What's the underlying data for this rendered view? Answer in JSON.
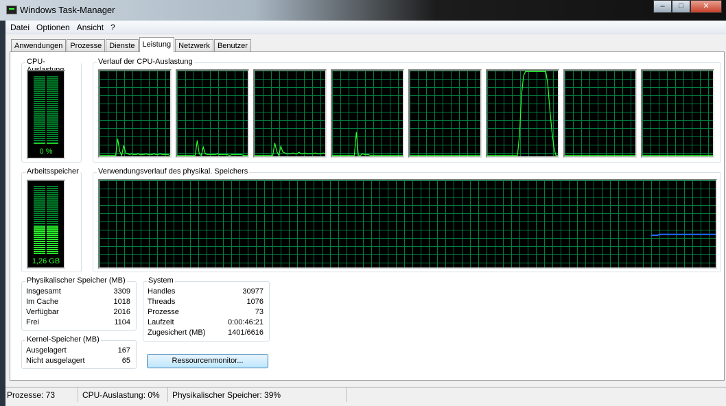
{
  "window": {
    "title": "Windows Task-Manager",
    "buttons": {
      "minimize": "–",
      "maximize": "□",
      "close": "✕"
    }
  },
  "menu": [
    "Datei",
    "Optionen",
    "Ansicht",
    "?"
  ],
  "tabs": [
    {
      "label": "Anwendungen"
    },
    {
      "label": "Prozesse"
    },
    {
      "label": "Dienste"
    },
    {
      "label": "Leistung",
      "active": true
    },
    {
      "label": "Netzwerk"
    },
    {
      "label": "Benutzer"
    }
  ],
  "cpu": {
    "label": "CPU-Auslastung",
    "value": "0 %",
    "percent": 0
  },
  "cpu_history": {
    "label": "Verlauf der CPU-Auslastung",
    "cores": [
      [
        0,
        0,
        0,
        0,
        0,
        0,
        0,
        0,
        0,
        20,
        5,
        0,
        12,
        3,
        2,
        1,
        2,
        1,
        1,
        2,
        1,
        1,
        1,
        2,
        1,
        1,
        1,
        2,
        1,
        1,
        2,
        1,
        1,
        1,
        1,
        0
      ],
      [
        0,
        0,
        0,
        0,
        0,
        0,
        0,
        0,
        0,
        0,
        18,
        2,
        0,
        10,
        2,
        1,
        1,
        1,
        1,
        1,
        2,
        1,
        1,
        1,
        1,
        1,
        0,
        1,
        1,
        1,
        1,
        1,
        1,
        0,
        0,
        0
      ],
      [
        0,
        0,
        0,
        0,
        0,
        0,
        0,
        0,
        0,
        0,
        15,
        5,
        0,
        11,
        4,
        3,
        2,
        2,
        2,
        3,
        2,
        2,
        4,
        2,
        2,
        3,
        2,
        2,
        2,
        2,
        3,
        2,
        2,
        2,
        3,
        2
      ],
      [
        0,
        0,
        0,
        0,
        0,
        0,
        0,
        0,
        0,
        0,
        0,
        0,
        28,
        0,
        0,
        2,
        1,
        1,
        1,
        0,
        0,
        0,
        0,
        0,
        0,
        0,
        0,
        0,
        0,
        0,
        0,
        0,
        0,
        0,
        0,
        0
      ],
      [
        0,
        0,
        0,
        0,
        0,
        0,
        0,
        0,
        0,
        0,
        0,
        0,
        0,
        0,
        0,
        0,
        0,
        0,
        0,
        0,
        0,
        0,
        0,
        0,
        0,
        0,
        0,
        0,
        0,
        0,
        0,
        0,
        0,
        0,
        0,
        0
      ],
      [
        0,
        0,
        0,
        0,
        0,
        0,
        0,
        0,
        0,
        0,
        0,
        0,
        0,
        0,
        0,
        0,
        25,
        72,
        95,
        100,
        100,
        100,
        100,
        100,
        100,
        100,
        100,
        100,
        100,
        100,
        85,
        55,
        30,
        10,
        0,
        0
      ],
      [
        0,
        0,
        0,
        0,
        0,
        0,
        0,
        0,
        0,
        0,
        0,
        0,
        0,
        0,
        0,
        0,
        0,
        0,
        0,
        0,
        0,
        0,
        0,
        0,
        0,
        0,
        0,
        0,
        0,
        0,
        0,
        0,
        0,
        0,
        0,
        0
      ],
      [
        0,
        0,
        0,
        0,
        0,
        0,
        0,
        0,
        0,
        0,
        0,
        0,
        0,
        0,
        0,
        0,
        0,
        0,
        0,
        0,
        0,
        0,
        0,
        0,
        0,
        0,
        0,
        0,
        0,
        0,
        0,
        0,
        0,
        0,
        0,
        0
      ]
    ]
  },
  "memory": {
    "label": "Arbeitsspeicher",
    "value": "1,26 GB",
    "percent": 39
  },
  "memory_history": {
    "label": "Verwendungsverlauf des physikal. Speichers",
    "values_percent": [
      37,
      37,
      37,
      37,
      38,
      38,
      38,
      38,
      38,
      38,
      38,
      38,
      38,
      38,
      38,
      38,
      38,
      38,
      38,
      38,
      38,
      38,
      38,
      38,
      38,
      38,
      38,
      38,
      38,
      38,
      38,
      38
    ]
  },
  "physical": {
    "label": "Physikalischer Speicher (MB)",
    "rows": [
      {
        "k": "Insgesamt",
        "v": "3309"
      },
      {
        "k": "Im Cache",
        "v": "1018"
      },
      {
        "k": "Verfügbar",
        "v": "2016"
      },
      {
        "k": "Frei",
        "v": "1104"
      }
    ]
  },
  "kernel": {
    "label": "Kernel-Speicher (MB)",
    "rows": [
      {
        "k": "Ausgelagert",
        "v": "167"
      },
      {
        "k": "Nicht ausgelagert",
        "v": "65"
      }
    ]
  },
  "system": {
    "label": "System",
    "rows": [
      {
        "k": "Handles",
        "v": "30977"
      },
      {
        "k": "Threads",
        "v": "1076"
      },
      {
        "k": "Prozesse",
        "v": "73"
      },
      {
        "k": "Laufzeit",
        "v": "0:00:46:21"
      },
      {
        "k": "Zugesichert (MB)",
        "v": "1401/6616"
      }
    ]
  },
  "resource_monitor_button": "Ressourcenmonitor...",
  "status": {
    "processes": "Prozesse: 73",
    "cpu": "CPU-Auslastung: 0%",
    "memory": "Physikalischer Speicher: 39%"
  },
  "colors": {
    "graph_line": "#2bff2b",
    "grid": "#008040",
    "memory_line": "#1e6fff"
  }
}
